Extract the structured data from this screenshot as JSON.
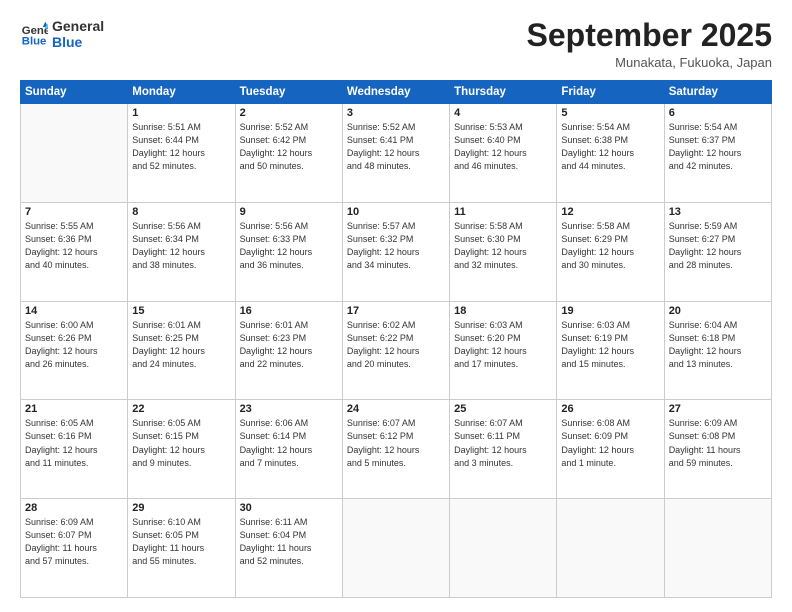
{
  "header": {
    "logo_line1": "General",
    "logo_line2": "Blue",
    "month": "September 2025",
    "location": "Munakata, Fukuoka, Japan"
  },
  "days_of_week": [
    "Sunday",
    "Monday",
    "Tuesday",
    "Wednesday",
    "Thursday",
    "Friday",
    "Saturday"
  ],
  "weeks": [
    [
      {
        "day": "",
        "info": ""
      },
      {
        "day": "1",
        "info": "Sunrise: 5:51 AM\nSunset: 6:44 PM\nDaylight: 12 hours\nand 52 minutes."
      },
      {
        "day": "2",
        "info": "Sunrise: 5:52 AM\nSunset: 6:42 PM\nDaylight: 12 hours\nand 50 minutes."
      },
      {
        "day": "3",
        "info": "Sunrise: 5:52 AM\nSunset: 6:41 PM\nDaylight: 12 hours\nand 48 minutes."
      },
      {
        "day": "4",
        "info": "Sunrise: 5:53 AM\nSunset: 6:40 PM\nDaylight: 12 hours\nand 46 minutes."
      },
      {
        "day": "5",
        "info": "Sunrise: 5:54 AM\nSunset: 6:38 PM\nDaylight: 12 hours\nand 44 minutes."
      },
      {
        "day": "6",
        "info": "Sunrise: 5:54 AM\nSunset: 6:37 PM\nDaylight: 12 hours\nand 42 minutes."
      }
    ],
    [
      {
        "day": "7",
        "info": "Sunrise: 5:55 AM\nSunset: 6:36 PM\nDaylight: 12 hours\nand 40 minutes."
      },
      {
        "day": "8",
        "info": "Sunrise: 5:56 AM\nSunset: 6:34 PM\nDaylight: 12 hours\nand 38 minutes."
      },
      {
        "day": "9",
        "info": "Sunrise: 5:56 AM\nSunset: 6:33 PM\nDaylight: 12 hours\nand 36 minutes."
      },
      {
        "day": "10",
        "info": "Sunrise: 5:57 AM\nSunset: 6:32 PM\nDaylight: 12 hours\nand 34 minutes."
      },
      {
        "day": "11",
        "info": "Sunrise: 5:58 AM\nSunset: 6:30 PM\nDaylight: 12 hours\nand 32 minutes."
      },
      {
        "day": "12",
        "info": "Sunrise: 5:58 AM\nSunset: 6:29 PM\nDaylight: 12 hours\nand 30 minutes."
      },
      {
        "day": "13",
        "info": "Sunrise: 5:59 AM\nSunset: 6:27 PM\nDaylight: 12 hours\nand 28 minutes."
      }
    ],
    [
      {
        "day": "14",
        "info": "Sunrise: 6:00 AM\nSunset: 6:26 PM\nDaylight: 12 hours\nand 26 minutes."
      },
      {
        "day": "15",
        "info": "Sunrise: 6:01 AM\nSunset: 6:25 PM\nDaylight: 12 hours\nand 24 minutes."
      },
      {
        "day": "16",
        "info": "Sunrise: 6:01 AM\nSunset: 6:23 PM\nDaylight: 12 hours\nand 22 minutes."
      },
      {
        "day": "17",
        "info": "Sunrise: 6:02 AM\nSunset: 6:22 PM\nDaylight: 12 hours\nand 20 minutes."
      },
      {
        "day": "18",
        "info": "Sunrise: 6:03 AM\nSunset: 6:20 PM\nDaylight: 12 hours\nand 17 minutes."
      },
      {
        "day": "19",
        "info": "Sunrise: 6:03 AM\nSunset: 6:19 PM\nDaylight: 12 hours\nand 15 minutes."
      },
      {
        "day": "20",
        "info": "Sunrise: 6:04 AM\nSunset: 6:18 PM\nDaylight: 12 hours\nand 13 minutes."
      }
    ],
    [
      {
        "day": "21",
        "info": "Sunrise: 6:05 AM\nSunset: 6:16 PM\nDaylight: 12 hours\nand 11 minutes."
      },
      {
        "day": "22",
        "info": "Sunrise: 6:05 AM\nSunset: 6:15 PM\nDaylight: 12 hours\nand 9 minutes."
      },
      {
        "day": "23",
        "info": "Sunrise: 6:06 AM\nSunset: 6:14 PM\nDaylight: 12 hours\nand 7 minutes."
      },
      {
        "day": "24",
        "info": "Sunrise: 6:07 AM\nSunset: 6:12 PM\nDaylight: 12 hours\nand 5 minutes."
      },
      {
        "day": "25",
        "info": "Sunrise: 6:07 AM\nSunset: 6:11 PM\nDaylight: 12 hours\nand 3 minutes."
      },
      {
        "day": "26",
        "info": "Sunrise: 6:08 AM\nSunset: 6:09 PM\nDaylight: 12 hours\nand 1 minute."
      },
      {
        "day": "27",
        "info": "Sunrise: 6:09 AM\nSunset: 6:08 PM\nDaylight: 11 hours\nand 59 minutes."
      }
    ],
    [
      {
        "day": "28",
        "info": "Sunrise: 6:09 AM\nSunset: 6:07 PM\nDaylight: 11 hours\nand 57 minutes."
      },
      {
        "day": "29",
        "info": "Sunrise: 6:10 AM\nSunset: 6:05 PM\nDaylight: 11 hours\nand 55 minutes."
      },
      {
        "day": "30",
        "info": "Sunrise: 6:11 AM\nSunset: 6:04 PM\nDaylight: 11 hours\nand 52 minutes."
      },
      {
        "day": "",
        "info": ""
      },
      {
        "day": "",
        "info": ""
      },
      {
        "day": "",
        "info": ""
      },
      {
        "day": "",
        "info": ""
      }
    ]
  ]
}
